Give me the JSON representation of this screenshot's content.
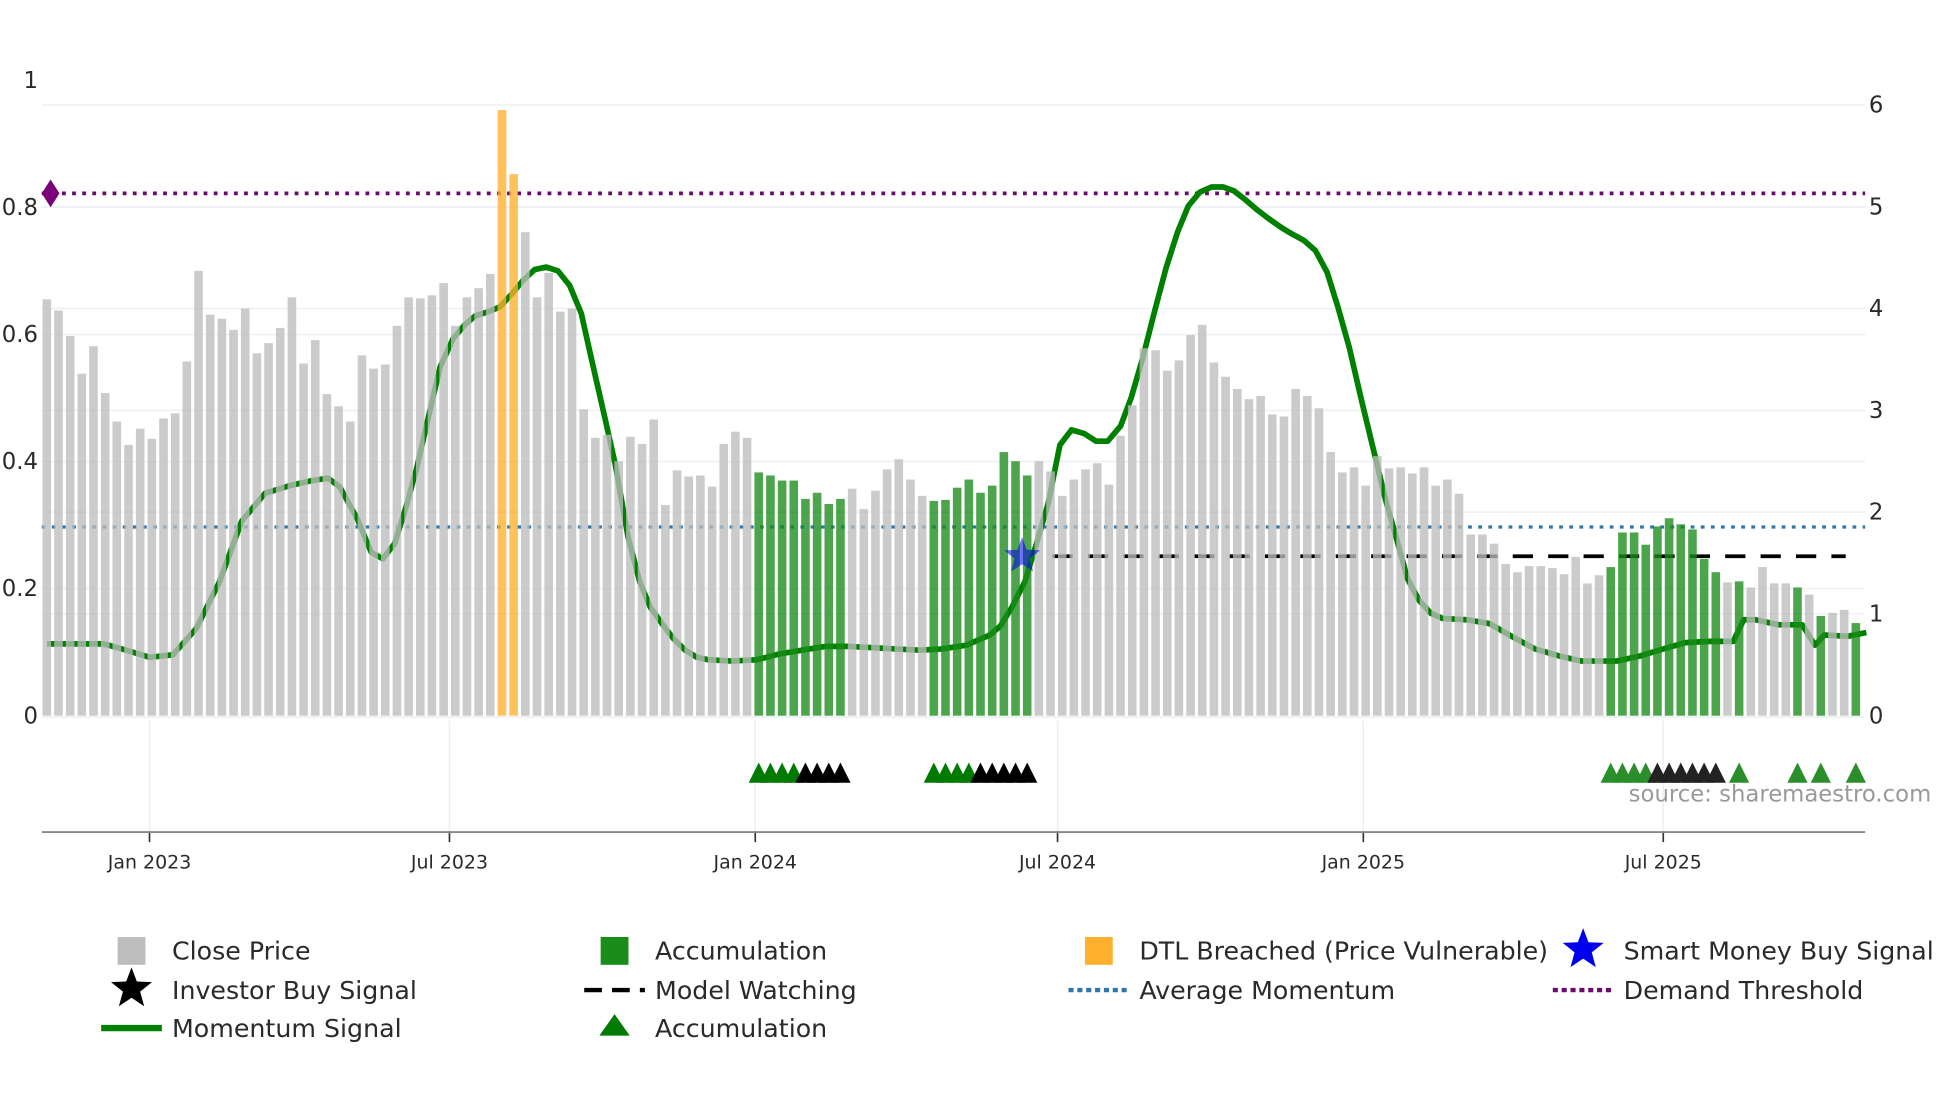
{
  "chart_data": {
    "type": "bar",
    "title": "",
    "xlabel": "",
    "ylabel_left": "",
    "ylabel_right": "",
    "left_axis": {
      "ylim": [
        0,
        1.04
      ],
      "ticks": [
        "0",
        "0.2",
        "0.4",
        "0.6",
        "0.8",
        "1"
      ],
      "tick_values": [
        0,
        0.2,
        0.4,
        0.6,
        0.8,
        1
      ]
    },
    "right_axis": {
      "ylim": [
        0,
        6.2
      ],
      "ticks": [
        "0",
        "1",
        "2",
        "3",
        "4",
        "5",
        "6"
      ],
      "tick_values": [
        0,
        1,
        2,
        3,
        4,
        5,
        6
      ]
    },
    "x_ticks": [
      {
        "label": "Jan 2023",
        "week": 8.8
      },
      {
        "label": "Jul 2023",
        "week": 34.5
      },
      {
        "label": "Jan 2024",
        "week": 60.7
      },
      {
        "label": "Jul 2024",
        "week": 86.6
      },
      {
        "label": "Jan 2025",
        "week": 112.8
      },
      {
        "label": "Jul 2025",
        "week": 138.5
      }
    ],
    "close_price": [
      4.09,
      3.98,
      3.73,
      3.36,
      3.63,
      3.17,
      2.89,
      2.66,
      2.82,
      2.72,
      2.92,
      2.97,
      3.48,
      4.37,
      3.94,
      3.9,
      3.79,
      4.0,
      3.56,
      3.66,
      3.81,
      4.11,
      3.46,
      3.69,
      3.16,
      3.04,
      2.89,
      3.54,
      3.41,
      3.45,
      3.83,
      4.11,
      4.1,
      4.13,
      4.25,
      3.83,
      4.11,
      4.2,
      4.34,
      5.95,
      5.32,
      4.75,
      4.11,
      4.35,
      3.97,
      4.0,
      3.01,
      2.73,
      2.76,
      2.5,
      2.74,
      2.67,
      2.91,
      2.07,
      2.41,
      2.35,
      2.36,
      2.25,
      2.67,
      2.79,
      2.73,
      2.39,
      2.36,
      2.31,
      2.31,
      2.13,
      2.19,
      2.08,
      2.13,
      2.23,
      2.03,
      2.21,
      2.42,
      2.52,
      2.32,
      2.16,
      2.11,
      2.12,
      2.24,
      2.32,
      2.19,
      2.26,
      2.59,
      2.5,
      2.36,
      2.5,
      2.4,
      2.16,
      2.32,
      2.42,
      2.48,
      2.27,
      2.75,
      3.05,
      3.61,
      3.59,
      3.39,
      3.49,
      3.74,
      3.84,
      3.47,
      3.33,
      3.21,
      3.11,
      3.14,
      2.96,
      2.94,
      3.21,
      3.14,
      3.02,
      2.59,
      2.39,
      2.44,
      2.26,
      2.55,
      2.43,
      2.44,
      2.38,
      2.44,
      2.26,
      2.32,
      2.18,
      1.78,
      1.78,
      1.69,
      1.49,
      1.41,
      1.47,
      1.47,
      1.45,
      1.39,
      1.56,
      1.3,
      1.38,
      1.46,
      1.8,
      1.8,
      1.68,
      1.86,
      1.94,
      1.88,
      1.83,
      1.54,
      1.41,
      1.31,
      1.32,
      1.26,
      1.46,
      1.3,
      1.3,
      1.26,
      1.19,
      0.98,
      1.01,
      1.04,
      0.91
    ],
    "accumulation_weeks": [
      61,
      62,
      63,
      64,
      65,
      66,
      67,
      68,
      76,
      77,
      78,
      79,
      80,
      81,
      82,
      83,
      84,
      134,
      135,
      136,
      137,
      138,
      139,
      140,
      141,
      142,
      143,
      145,
      150,
      152,
      155
    ],
    "dtl_breached_weeks": [
      39,
      40
    ],
    "momentum_signal": [
      [
        0,
        0.113
      ],
      [
        4.9,
        0.113
      ],
      [
        6.8,
        0.103
      ],
      [
        8.8,
        0.092
      ],
      [
        10.8,
        0.096
      ],
      [
        12.8,
        0.137
      ],
      [
        14.8,
        0.211
      ],
      [
        16.7,
        0.306
      ],
      [
        18.7,
        0.35
      ],
      [
        20.8,
        0.362
      ],
      [
        22.7,
        0.37
      ],
      [
        24.1,
        0.374
      ],
      [
        25.1,
        0.36
      ],
      [
        26.6,
        0.31
      ],
      [
        27.8,
        0.257
      ],
      [
        28.8,
        0.247
      ],
      [
        29.8,
        0.271
      ],
      [
        30.8,
        0.33
      ],
      [
        31.7,
        0.39
      ],
      [
        32.7,
        0.47
      ],
      [
        33.7,
        0.549
      ],
      [
        34.8,
        0.593
      ],
      [
        35.8,
        0.615
      ],
      [
        36.7,
        0.629
      ],
      [
        37.7,
        0.635
      ],
      [
        38.8,
        0.643
      ],
      [
        39.8,
        0.663
      ],
      [
        40.8,
        0.685
      ],
      [
        41.8,
        0.702
      ],
      [
        42.8,
        0.706
      ],
      [
        43.8,
        0.7
      ],
      [
        44.8,
        0.677
      ],
      [
        45.8,
        0.633
      ],
      [
        46.7,
        0.559
      ],
      [
        47.8,
        0.47
      ],
      [
        48.7,
        0.396
      ],
      [
        49.8,
        0.281
      ],
      [
        50.8,
        0.211
      ],
      [
        51.7,
        0.171
      ],
      [
        52.7,
        0.145
      ],
      [
        53.7,
        0.121
      ],
      [
        54.7,
        0.103
      ],
      [
        55.7,
        0.092
      ],
      [
        56.7,
        0.088
      ],
      [
        58.7,
        0.086
      ],
      [
        60.8,
        0.088
      ],
      [
        61.7,
        0.092
      ],
      [
        62.7,
        0.097
      ],
      [
        64.7,
        0.103
      ],
      [
        66.7,
        0.109
      ],
      [
        68.7,
        0.109
      ],
      [
        70.8,
        0.107
      ],
      [
        72.7,
        0.105
      ],
      [
        74.8,
        0.103
      ],
      [
        76.7,
        0.105
      ],
      [
        78.8,
        0.111
      ],
      [
        80.8,
        0.127
      ],
      [
        81.7,
        0.141
      ],
      [
        82.7,
        0.171
      ],
      [
        83.8,
        0.211
      ],
      [
        84.8,
        0.271
      ],
      [
        85.8,
        0.334
      ],
      [
        86.8,
        0.426
      ],
      [
        87.8,
        0.45
      ],
      [
        88.9,
        0.444
      ],
      [
        89.9,
        0.432
      ],
      [
        90.9,
        0.432
      ],
      [
        92.0,
        0.456
      ],
      [
        92.9,
        0.5
      ],
      [
        93.9,
        0.563
      ],
      [
        94.9,
        0.635
      ],
      [
        95.9,
        0.705
      ],
      [
        96.9,
        0.762
      ],
      [
        97.8,
        0.802
      ],
      [
        98.8,
        0.824
      ],
      [
        99.8,
        0.832
      ],
      [
        100.8,
        0.832
      ],
      [
        101.7,
        0.826
      ],
      [
        102.7,
        0.812
      ],
      [
        103.7,
        0.796
      ],
      [
        104.7,
        0.782
      ],
      [
        105.8,
        0.768
      ],
      [
        106.7,
        0.758
      ],
      [
        107.7,
        0.748
      ],
      [
        108.7,
        0.732
      ],
      [
        109.7,
        0.698
      ],
      [
        110.6,
        0.645
      ],
      [
        111.6,
        0.579
      ],
      [
        112.6,
        0.5
      ],
      [
        113.7,
        0.416
      ],
      [
        114.7,
        0.34
      ],
      [
        115.7,
        0.275
      ],
      [
        116.6,
        0.215
      ],
      [
        117.6,
        0.181
      ],
      [
        118.6,
        0.161
      ],
      [
        119.6,
        0.153
      ],
      [
        121.6,
        0.151
      ],
      [
        123.6,
        0.145
      ],
      [
        125.5,
        0.125
      ],
      [
        127.5,
        0.105
      ],
      [
        129.6,
        0.094
      ],
      [
        131.5,
        0.086
      ],
      [
        134.5,
        0.086
      ],
      [
        136.5,
        0.094
      ],
      [
        138.5,
        0.105
      ],
      [
        140.4,
        0.115
      ],
      [
        142.4,
        0.117
      ],
      [
        144.5,
        0.117
      ],
      [
        145.4,
        0.151
      ],
      [
        146.4,
        0.151
      ],
      [
        148.4,
        0.143
      ],
      [
        150.4,
        0.143
      ],
      [
        151.5,
        0.111
      ],
      [
        152.3,
        0.127
      ],
      [
        154.3,
        0.125
      ],
      [
        155.9,
        0.131
      ]
    ],
    "average_momentum": 0.297,
    "demand_threshold": 0.822,
    "model_watching": {
      "level": 0.251,
      "from_week": 84,
      "to_week": 155
    },
    "smart_money_buy_signal": {
      "week": 84,
      "value": 0.251
    },
    "accumulation_markers": [
      61,
      62,
      63,
      64,
      76,
      77,
      78,
      79,
      134,
      135,
      136,
      137,
      145,
      150,
      152,
      155
    ],
    "black_markers": [
      65,
      66,
      67,
      68,
      80,
      81,
      82,
      83,
      84,
      138,
      139,
      140,
      141,
      142,
      143
    ],
    "colors": {
      "close_price": "#bdbdbd",
      "accumulation": "#1a8c1a",
      "dtl": "#ffb02e",
      "momentum": "#008000",
      "average_momentum": "#2f77a8",
      "demand_threshold": "#6b0a6b",
      "model_watching": "#000000",
      "smart_money": "#0000ee"
    },
    "legend": {
      "placement": "bottom",
      "items": [
        {
          "label": "Close Price",
          "icon": "gray-square"
        },
        {
          "label": "Accumulation",
          "icon": "green-square"
        },
        {
          "label": "DTL Breached (Price Vulnerable)",
          "icon": "orange-square"
        },
        {
          "label": "Smart Money Buy Signal",
          "icon": "blue-star"
        },
        {
          "label": "Investor Buy Signal",
          "icon": "black-star"
        },
        {
          "label": "Model Watching",
          "icon": "black-dashed-line"
        },
        {
          "label": "Average Momentum",
          "icon": "blue-dotted-line"
        },
        {
          "label": "Demand Threshold",
          "icon": "purple-dotted-line"
        },
        {
          "label": "Momentum Signal",
          "icon": "green-line"
        },
        {
          "label": "Accumulation",
          "icon": "green-triangle"
        }
      ]
    },
    "source": "source: sharemaestro.com"
  }
}
